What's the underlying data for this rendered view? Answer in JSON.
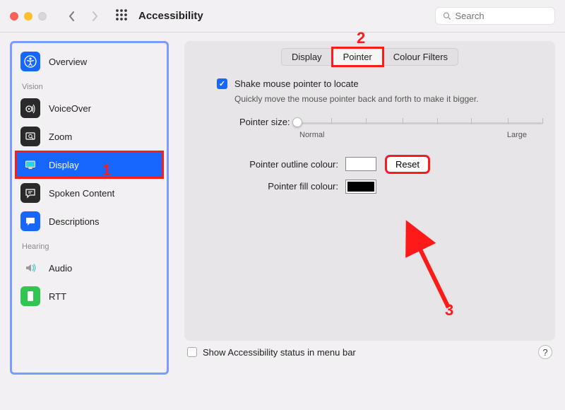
{
  "window": {
    "title": "Accessibility"
  },
  "search": {
    "placeholder": "Search"
  },
  "sidebar": {
    "items": [
      {
        "label": "Overview",
        "icon": "accessibility",
        "bg": "#1767ff",
        "fg": "#fff"
      }
    ],
    "section_vision": "Vision",
    "vision_items": [
      {
        "label": "VoiceOver",
        "icon": "voiceover",
        "bg": "#2a2a2a",
        "fg": "#fff"
      },
      {
        "label": "Zoom",
        "icon": "zoom",
        "bg": "#2a2a2a",
        "fg": "#fff"
      },
      {
        "label": "Display",
        "icon": "display",
        "bg": "#1767ff",
        "fg": "#fff",
        "selected": true
      },
      {
        "label": "Spoken Content",
        "icon": "speech",
        "bg": "#2a2a2a",
        "fg": "#fff"
      },
      {
        "label": "Descriptions",
        "icon": "descriptions",
        "bg": "#1767ff",
        "fg": "#fff"
      }
    ],
    "section_hearing": "Hearing",
    "hearing_items": [
      {
        "label": "Audio",
        "icon": "audio",
        "bg": "#c7c7c7",
        "fg": "#5ec9c6"
      },
      {
        "label": "RTT",
        "icon": "rtt",
        "bg": "#31c552",
        "fg": "#fff"
      }
    ]
  },
  "tabs": [
    "Display",
    "Pointer",
    "Colour Filters"
  ],
  "tab_active_index": 1,
  "checkbox": {
    "checked": true,
    "label": "Shake mouse pointer to locate",
    "desc": "Quickly move the mouse pointer back and forth to make it bigger."
  },
  "slider": {
    "label": "Pointer size:",
    "min_label": "Normal",
    "max_label": "Large",
    "value_percent": 0
  },
  "pointer_outline": {
    "label": "Pointer outline colour:",
    "colour": "#ffffff"
  },
  "pointer_fill": {
    "label": "Pointer fill colour:",
    "colour": "#000000"
  },
  "reset_button": "Reset",
  "footer": {
    "checkbox_label": "Show Accessibility status in menu bar"
  },
  "annotations": {
    "one": "1",
    "two": "2",
    "three": "3"
  }
}
